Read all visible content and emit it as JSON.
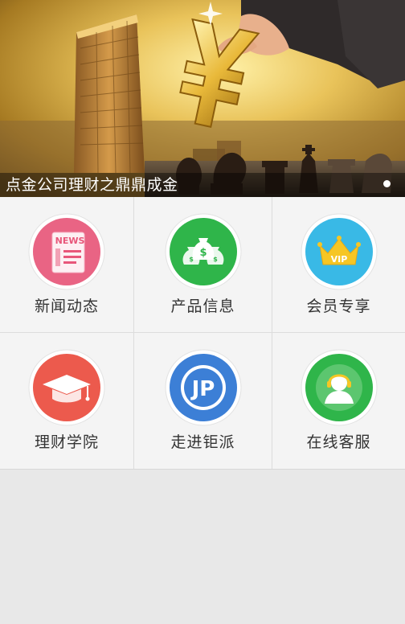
{
  "banner": {
    "caption": "点金公司理财之鼎鼎成金",
    "symbol": "¥",
    "active_slide": 1,
    "slide_count": 1
  },
  "menu": [
    {
      "label": "新闻动态",
      "icon": "news-icon",
      "color": "#e8577a",
      "badge": "NEWS"
    },
    {
      "label": "产品信息",
      "icon": "money-bags-icon",
      "color": "#2fb54a"
    },
    {
      "label": "会员专享",
      "icon": "vip-crown-icon",
      "color": "#39b9e6",
      "badge": "VIP"
    },
    {
      "label": "理财学院",
      "icon": "graduation-cap-icon",
      "color": "#ec5a4d"
    },
    {
      "label": "走进钜派",
      "icon": "jp-logo-icon",
      "color": "#3c7fd6",
      "badge": "JP"
    },
    {
      "label": "在线客服",
      "icon": "customer-service-icon",
      "color": "#2fb54a"
    }
  ]
}
